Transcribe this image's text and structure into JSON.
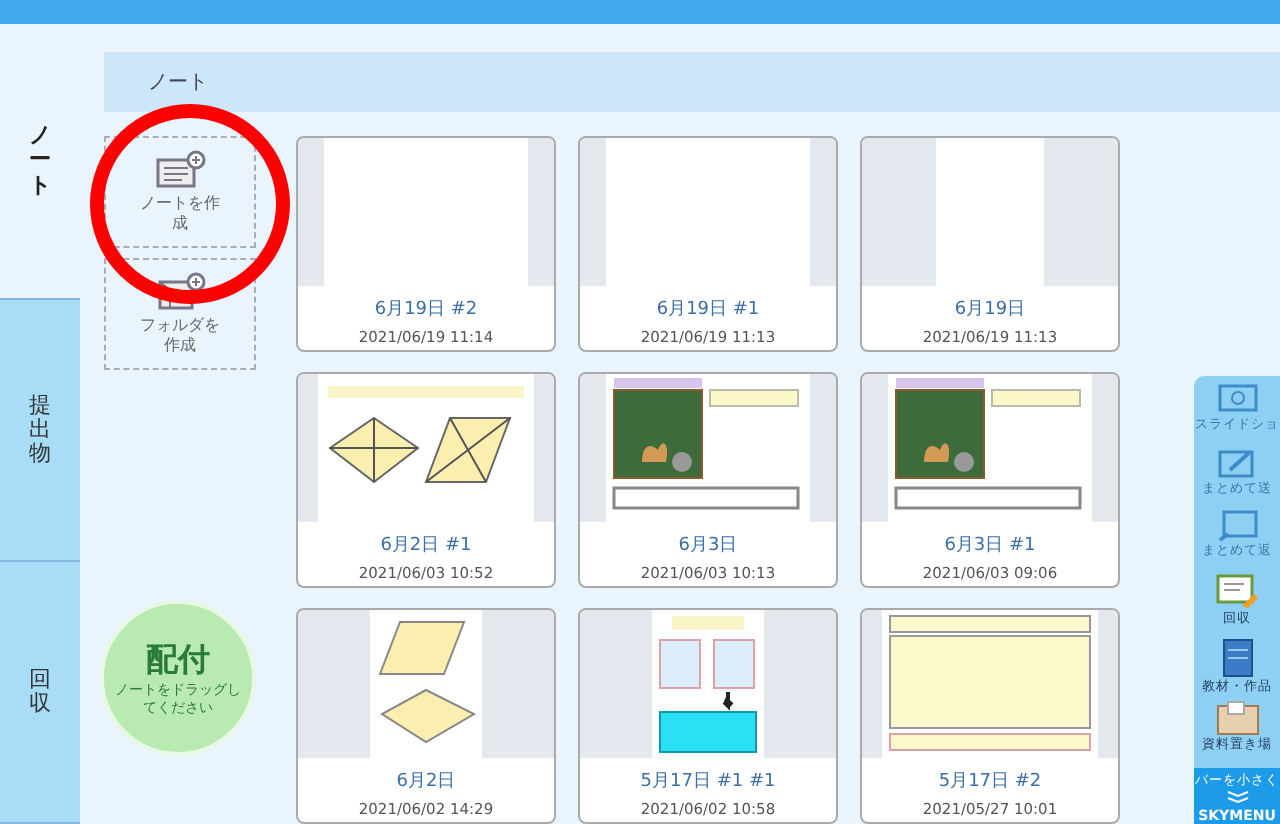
{
  "side_tabs": [
    {
      "label": "ノート",
      "selected": true
    },
    {
      "label": "提出物",
      "selected": false
    },
    {
      "label": "回収",
      "selected": false
    }
  ],
  "header": {
    "title": "ノート"
  },
  "create_buttons": [
    {
      "kind": "note",
      "label": "ノートを作成"
    },
    {
      "kind": "folder",
      "label": "フォルダを作成"
    }
  ],
  "distribute": {
    "title": "配付",
    "hint": "ノートをドラッグしてください"
  },
  "notes": [
    {
      "kind": "blank",
      "title": "6月19日 #2",
      "date": "2021/06/19 11:14"
    },
    {
      "kind": "blank",
      "title": "6月19日 #1",
      "date": "2021/06/19 11:13"
    },
    {
      "kind": "narrow",
      "title": "6月19日",
      "date": "2021/06/19 11:13"
    },
    {
      "kind": "diamonds",
      "title": "6月2日 #1",
      "date": "2021/06/03 10:52"
    },
    {
      "kind": "chalkboard",
      "title": "6月3日",
      "date": "2021/06/03 10:13"
    },
    {
      "kind": "chalkboard",
      "title": "6月3日 #1",
      "date": "2021/06/03 09:06"
    },
    {
      "kind": "shapes",
      "title": "6月2日",
      "date": "2021/06/02 14:29"
    },
    {
      "kind": "worksheet",
      "title": "5月17日 #1 #1",
      "date": "2021/06/02 10:58"
    },
    {
      "kind": "form",
      "title": "5月17日 #2",
      "date": "2021/05/27 10:01"
    }
  ],
  "toolbar": {
    "items": [
      {
        "kind": "slide",
        "label": "スライドショ",
        "disabled": true
      },
      {
        "kind": "send",
        "label": "まとめて送",
        "disabled": true
      },
      {
        "kind": "return",
        "label": "まとめて返",
        "disabled": true
      },
      {
        "kind": "collect",
        "label": "回収",
        "disabled": false
      },
      {
        "kind": "book",
        "label": "教材・作品",
        "disabled": false
      },
      {
        "kind": "box",
        "label": "資料置き場",
        "disabled": false
      }
    ],
    "shrink": "バーを小さく",
    "logo": "SKYMENU"
  }
}
